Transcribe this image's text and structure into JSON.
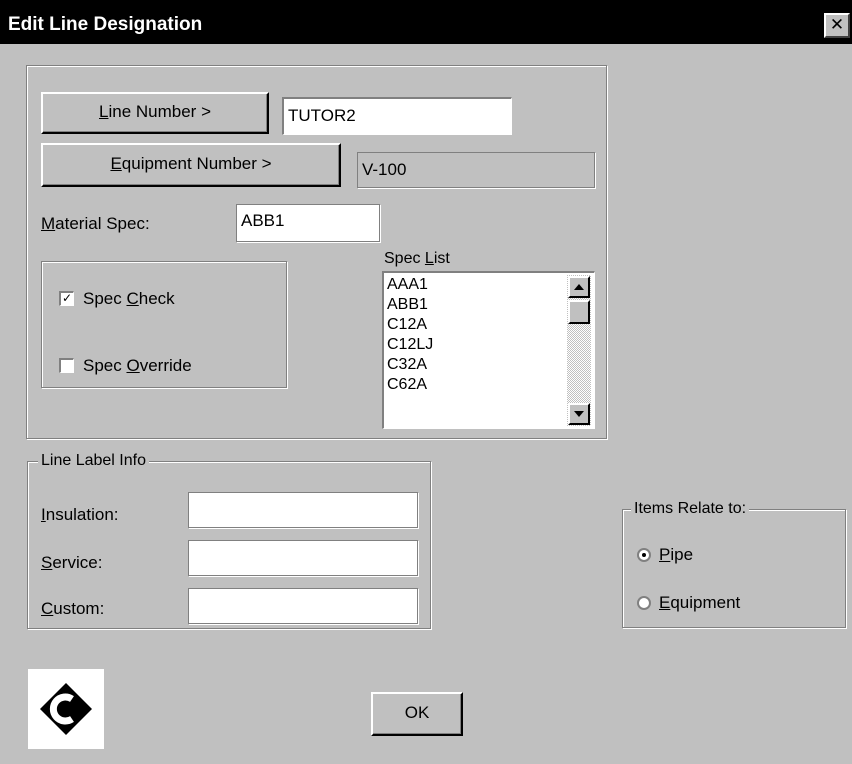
{
  "window": {
    "title": "Edit Line Designation",
    "close_label": "✕"
  },
  "line_number_button": {
    "pre": "",
    "mnemonic": "L",
    "post": "ine Number >"
  },
  "line_number_value": "TUTOR2",
  "equipment_number_button": {
    "pre": "",
    "mnemonic": "E",
    "post": "quipment Number >"
  },
  "equipment_number_value": "V-100",
  "material_spec": {
    "pre": "",
    "mnemonic": "M",
    "post": "aterial Spec:",
    "value": "ABB1"
  },
  "spec_check": {
    "pre": "Spec ",
    "mnemonic": "C",
    "post": "heck",
    "checked": true
  },
  "spec_override": {
    "pre": "Spec ",
    "mnemonic": "O",
    "post": "verride",
    "checked": false
  },
  "spec_list": {
    "label_pre": "Spec ",
    "label_mnemonic": "L",
    "label_post": "ist",
    "items": [
      "AAA1",
      "ABB1",
      "C12A",
      "C12LJ",
      "C32A",
      "C62A"
    ]
  },
  "line_label_info": {
    "title": "Line Label Info",
    "insulation": {
      "pre": "",
      "mnemonic": "I",
      "post": "nsulation:",
      "value": ""
    },
    "service": {
      "pre": "",
      "mnemonic": "S",
      "post": "ervice:",
      "value": ""
    },
    "custom": {
      "pre": "",
      "mnemonic": "C",
      "post": "ustom:",
      "value": ""
    }
  },
  "items_relate_to": {
    "title": "Items Relate to:",
    "pipe": {
      "pre": "",
      "mnemonic": "P",
      "post": "ipe",
      "selected": true
    },
    "equipment": {
      "pre": "",
      "mnemonic": "E",
      "post": "quipment",
      "selected": false
    }
  },
  "ok_button": "OK",
  "logo": {
    "letter": "C"
  },
  "colors": {
    "titlebar": "#000000",
    "dialog": "#c0c0c0",
    "field": "#ffffff"
  },
  "icons": {
    "close": "close-icon",
    "logo": "app-logo-icon",
    "check": "checkmark-icon"
  }
}
